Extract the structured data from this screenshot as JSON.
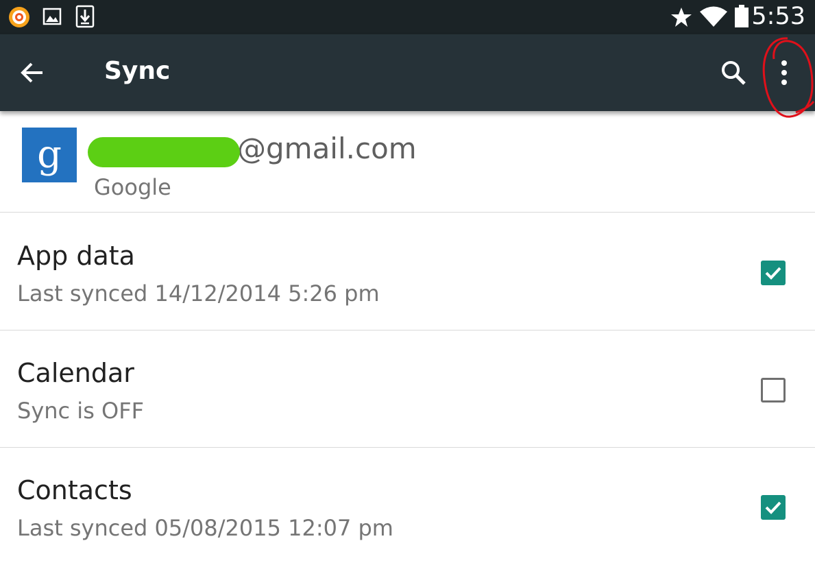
{
  "status_bar": {
    "time": "5:53",
    "icons": [
      "notification-app-icon",
      "gallery-icon",
      "download-icon",
      "star-icon",
      "wifi-icon",
      "battery-icon"
    ]
  },
  "toolbar": {
    "title": "Sync",
    "back_icon": "arrow-back-icon",
    "search_icon": "search-icon",
    "more_icon": "more-vert-icon"
  },
  "account": {
    "email_visible": "@gmail.com",
    "provider": "Google",
    "logo_letter": "g"
  },
  "sync_items": [
    {
      "label": "App data",
      "status": "Last synced 14/12/2014 5:26 pm",
      "checked": true
    },
    {
      "label": "Calendar",
      "status": "Sync is OFF",
      "checked": false
    },
    {
      "label": "Contacts",
      "status": "Last synced 05/08/2015 12:07 pm",
      "checked": true
    }
  ],
  "colors": {
    "toolbar": "#263238",
    "status_bar": "#1b2326",
    "checkbox_on": "#15907f",
    "annotation": "#e0101a",
    "redaction": "#5ccf14"
  }
}
